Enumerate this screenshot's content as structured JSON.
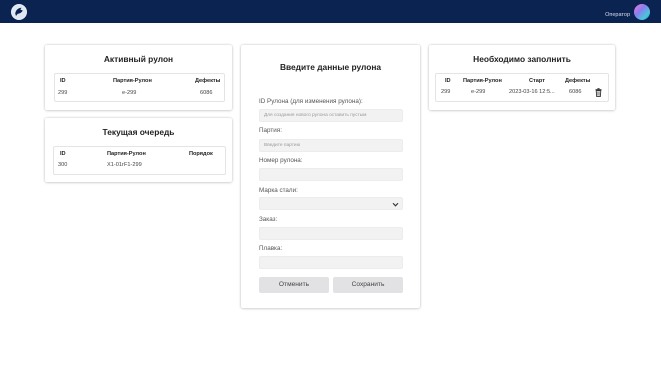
{
  "header": {
    "operator_label": "Оператор"
  },
  "active_roll": {
    "title": "Активный рулон",
    "columns": [
      "ID",
      "Партия-Рулон",
      "Дефекты"
    ],
    "rows": [
      {
        "id": "299",
        "batch_roll": "е-299",
        "defects": "6086"
      }
    ]
  },
  "queue": {
    "title": "Текущая очередь",
    "columns": [
      "ID",
      "Партия-Рулон",
      "Порядок"
    ],
    "rows": [
      {
        "id": "300",
        "batch_roll": "Х1-01гF1-299",
        "order": ""
      }
    ]
  },
  "form": {
    "title": "Введите данные рулона",
    "fields": [
      {
        "label": "ID Рулона (для изменения рулона):",
        "placeholder": "Для создания нового рулона оставить пустым"
      },
      {
        "label": "Партия:",
        "placeholder": "Введите партию"
      },
      {
        "label": "Номер рулона:",
        "placeholder": ""
      },
      {
        "label": "Марка стали:",
        "placeholder": ""
      },
      {
        "label": "Заказ:",
        "placeholder": ""
      },
      {
        "label": "Плавка:",
        "placeholder": ""
      }
    ],
    "cancel_label": "Отменить",
    "save_label": "Сохранить"
  },
  "to_fill": {
    "title": "Необходимо заполнить",
    "columns": [
      "ID",
      "Партия-Рулон",
      "Старт",
      "Дефекты"
    ],
    "rows": [
      {
        "id": "299",
        "batch_roll": "е-299",
        "start": "2023-03-16 12:5...",
        "defects": "6086"
      }
    ],
    "row_icon": "trash-icon"
  }
}
